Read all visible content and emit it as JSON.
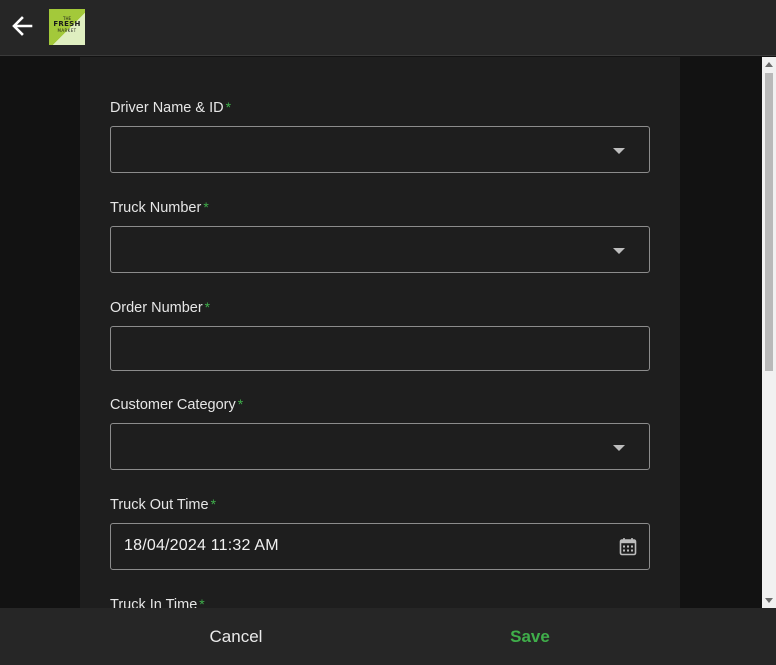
{
  "header": {
    "back_icon": "arrow-left-icon",
    "logo": {
      "line1": "THE",
      "line2": "FRESH",
      "line3": "MARKET"
    }
  },
  "form": {
    "fields": [
      {
        "label": "Driver Name & ID",
        "required_mark": "*",
        "type": "select",
        "value": ""
      },
      {
        "label": "Truck Number",
        "required_mark": "*",
        "type": "select",
        "value": ""
      },
      {
        "label": "Order Number",
        "required_mark": "*",
        "type": "text",
        "value": ""
      },
      {
        "label": "Customer Category",
        "required_mark": "*",
        "type": "select",
        "value": ""
      },
      {
        "label": "Truck Out Time",
        "required_mark": "*",
        "type": "datetime",
        "value": "18/04/2024 11:32 AM",
        "icon": "calendar-icon"
      },
      {
        "label": "Truck In Time",
        "required_mark": "*",
        "type": "datetime",
        "value": ""
      }
    ]
  },
  "footer": {
    "cancel_label": "Cancel",
    "save_label": "Save"
  },
  "colors": {
    "accent": "#3fae4a",
    "header_bg": "#262626",
    "panel_bg": "#1e1e1e",
    "page_bg": "#121212"
  }
}
